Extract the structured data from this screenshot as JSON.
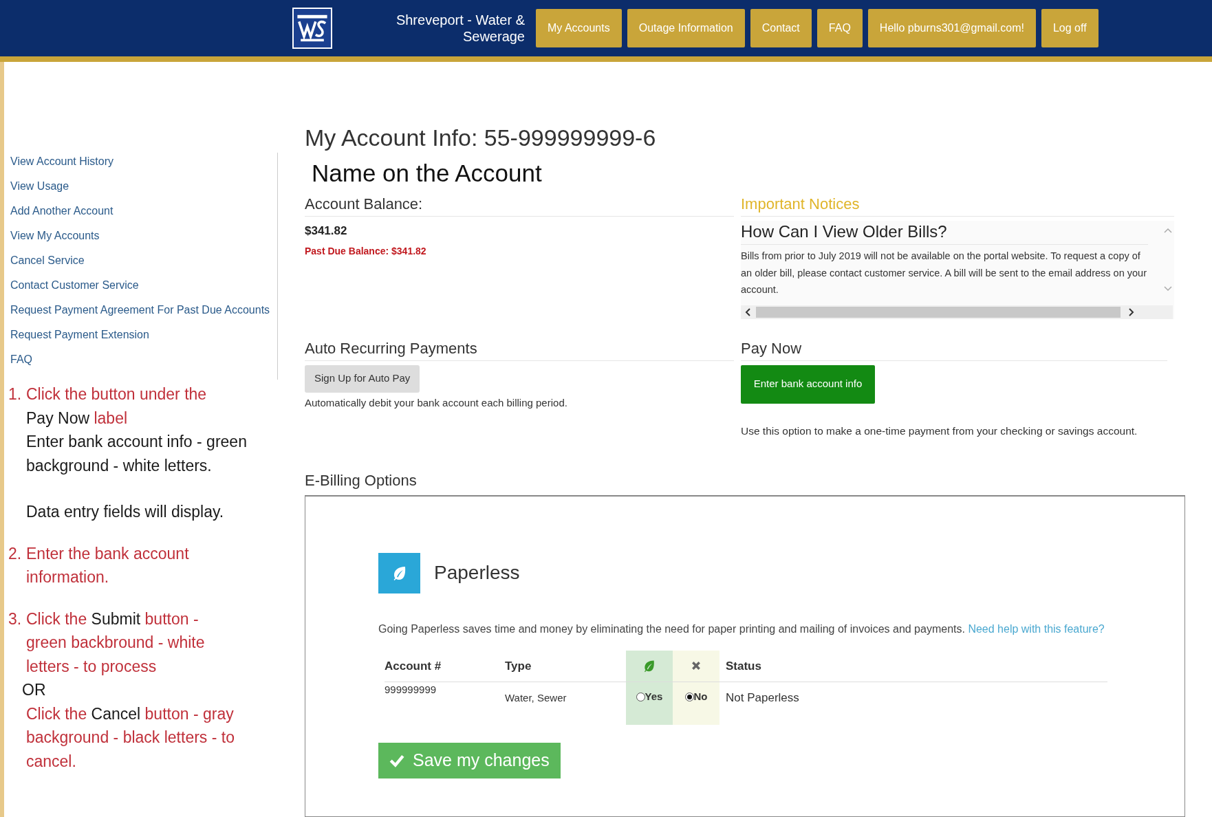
{
  "header": {
    "title_line1": "Shreveport - Water &",
    "title_line2": "Sewerage",
    "nav": [
      {
        "label": "My Accounts"
      },
      {
        "label": "Outage Information"
      },
      {
        "label": "Contact"
      },
      {
        "label": "FAQ"
      },
      {
        "label": "Hello pburns301@gmail.com!"
      },
      {
        "label": "Log off"
      }
    ]
  },
  "sidebar": {
    "items": [
      "View Account History",
      "View Usage",
      "Add Another Account",
      "View My Accounts",
      "Cancel Service",
      "Contact Customer Service",
      "Request Payment Agreement For Past Due Accounts",
      "Request Payment Extension",
      "FAQ"
    ]
  },
  "instructions": [
    {
      "number": "1.",
      "lines": [
        {
          "kind": "line",
          "segments": [
            {
              "text": "Click the button under the",
              "color": "#c0303a"
            }
          ]
        },
        {
          "kind": "line",
          "segments": [
            {
              "text": "Pay Now ",
              "color": "#1a1a1a"
            },
            {
              "text": "label",
              "color": "#c0303a"
            }
          ]
        },
        {
          "kind": "line",
          "segments": [
            {
              "text": "Enter bank account info - green",
              "color": "#1a1a1a"
            }
          ]
        },
        {
          "kind": "line",
          "segments": [
            {
              "text": "background - white letters.",
              "color": "#1a1a1a"
            }
          ]
        },
        {
          "kind": "spaced",
          "segments": [
            {
              "text": "Data entry fields will display.",
              "color": "#1a1a1a"
            }
          ]
        }
      ]
    },
    {
      "number": "2.",
      "lines": [
        {
          "kind": "line",
          "segments": [
            {
              "text": "Enter the bank account",
              "color": "#c0303a"
            }
          ]
        },
        {
          "kind": "line",
          "segments": [
            {
              "text": "information.",
              "color": "#c0303a"
            }
          ]
        }
      ]
    },
    {
      "number": "3.",
      "lines": [
        {
          "kind": "line",
          "segments": [
            {
              "text": "Click the ",
              "color": "#c0303a"
            },
            {
              "text": "Submit ",
              "color": "#1a1a1a"
            },
            {
              "text": "button -",
              "color": "#c0303a"
            }
          ]
        },
        {
          "kind": "line",
          "segments": [
            {
              "text": "green backbround - white",
              "color": "#c0303a"
            }
          ]
        },
        {
          "kind": "line",
          "segments": [
            {
              "text": "letters - to process",
              "color": "#c0303a"
            }
          ]
        },
        {
          "kind": "outdent",
          "segments": [
            {
              "text": "OR",
              "color": "#1a1a1a"
            }
          ]
        },
        {
          "kind": "line",
          "segments": [
            {
              "text": "Click the ",
              "color": "#c0303a"
            },
            {
              "text": "Cancel ",
              "color": "#1a1a1a"
            },
            {
              "text": "button - gray",
              "color": "#c0303a"
            }
          ]
        },
        {
          "kind": "line",
          "segments": [
            {
              "text": "background - black letters - to",
              "color": "#c0303a"
            }
          ]
        },
        {
          "kind": "line",
          "segments": [
            {
              "text": "cancel.",
              "color": "#c0303a"
            }
          ]
        }
      ]
    }
  ],
  "account": {
    "title": "My Account Info: 55-999999999-6",
    "name": "Name on the Account",
    "balance_heading": "Account Balance:",
    "balance": "$341.82",
    "past_due": "Past Due Balance: $341.82"
  },
  "notices": {
    "heading": "Important Notices",
    "title": "How Can I View Older Bills?",
    "body": "Bills from prior to July 2019 will not be available on the portal website. To request a copy of an older bill, please contact customer service. A bill will be sent to the email address on your account."
  },
  "auto_pay": {
    "heading": "Auto Recurring Payments",
    "button": "Sign Up for Auto Pay",
    "note": "Automatically debit your bank account each billing period."
  },
  "pay_now": {
    "heading": "Pay Now",
    "button": "Enter bank account info",
    "note": "Use this option to make a one-time payment from your checking or savings account."
  },
  "ebilling": {
    "heading": "E-Billing Options",
    "title": "Paperless",
    "description": "Going Paperless saves time and money by eliminating the need for paper printing and mailing of invoices and payments.",
    "help_link": "Need help with this feature?",
    "columns": [
      "Account #",
      "Type",
      "Status"
    ],
    "row": {
      "account": "999999999",
      "type": "Water, Sewer",
      "options": [
        {
          "label": "Yes",
          "selected": false
        },
        {
          "label": "No",
          "selected": true
        }
      ],
      "status": "Not Paperless"
    },
    "save_button": "Save my changes"
  }
}
